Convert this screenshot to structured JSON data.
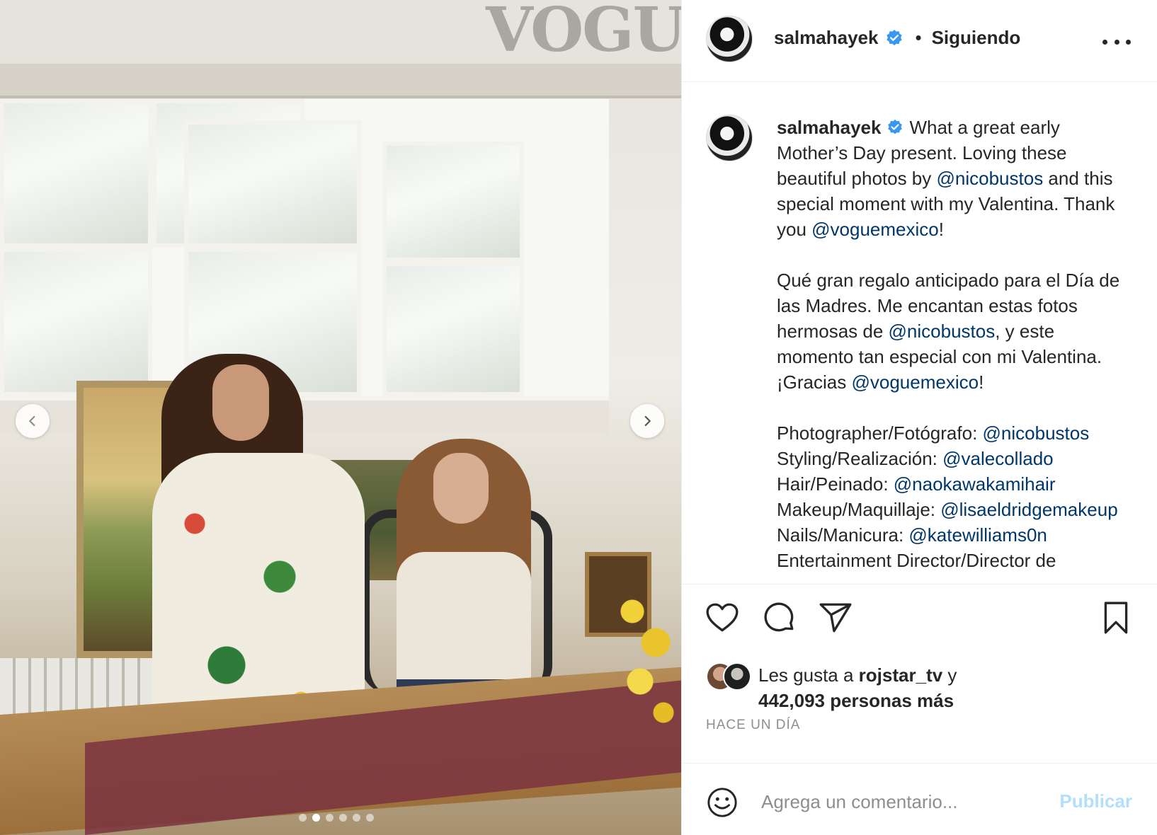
{
  "media": {
    "watermark": "VOGUE",
    "carousel_total": 6,
    "carousel_active_index": 1
  },
  "header": {
    "username": "salmahayek",
    "separator": "•",
    "follow_status": "Siguiendo"
  },
  "caption": {
    "username": "salmahayek",
    "paragraph1": {
      "t1": "What a great early Mother’s Day present. Loving these beautiful photos by ",
      "m1": "@nicobustos",
      "t2": " and this special moment with my Valentina. Thank you ",
      "m2": "@voguemexico",
      "t3": "!"
    },
    "paragraph2": {
      "t1": "Qué gran regalo anticipado para el Día de las Madres. Me encantan estas fotos hermosas de ",
      "m1": "@nicobustos",
      "t2": ", y este momento tan especial con mi Valentina. ¡Gracias ",
      "m2": "@voguemexico",
      "t3": "!"
    },
    "credits": [
      {
        "label": "Photographer/Fotógrafo: ",
        "mention": "@nicobustos"
      },
      {
        "label": "Styling/Realización: ",
        "mention": "@valecollado"
      },
      {
        "label": "Hair/Peinado: ",
        "mention": "@naokawakamihair"
      },
      {
        "label": "Makeup/Maquillaje: ",
        "mention": "@lisaeldridgemakeup"
      },
      {
        "label": "Nails/Manicura: ",
        "mention": "@katewilliams0n"
      },
      {
        "label": "Entertainment Director/Director de",
        "mention": ""
      }
    ]
  },
  "likes": {
    "prefix": "Les gusta a ",
    "user": "rojstar_tv",
    "suffix": " y",
    "count_text": "442,093 personas más"
  },
  "timestamp": "HACE UN DÍA",
  "comment": {
    "placeholder": "Agrega un comentario...",
    "publish_label": "Publicar"
  },
  "colors": {
    "link": "#00376b",
    "verified": "#3897f0",
    "publish_disabled": "#b2dffc"
  }
}
